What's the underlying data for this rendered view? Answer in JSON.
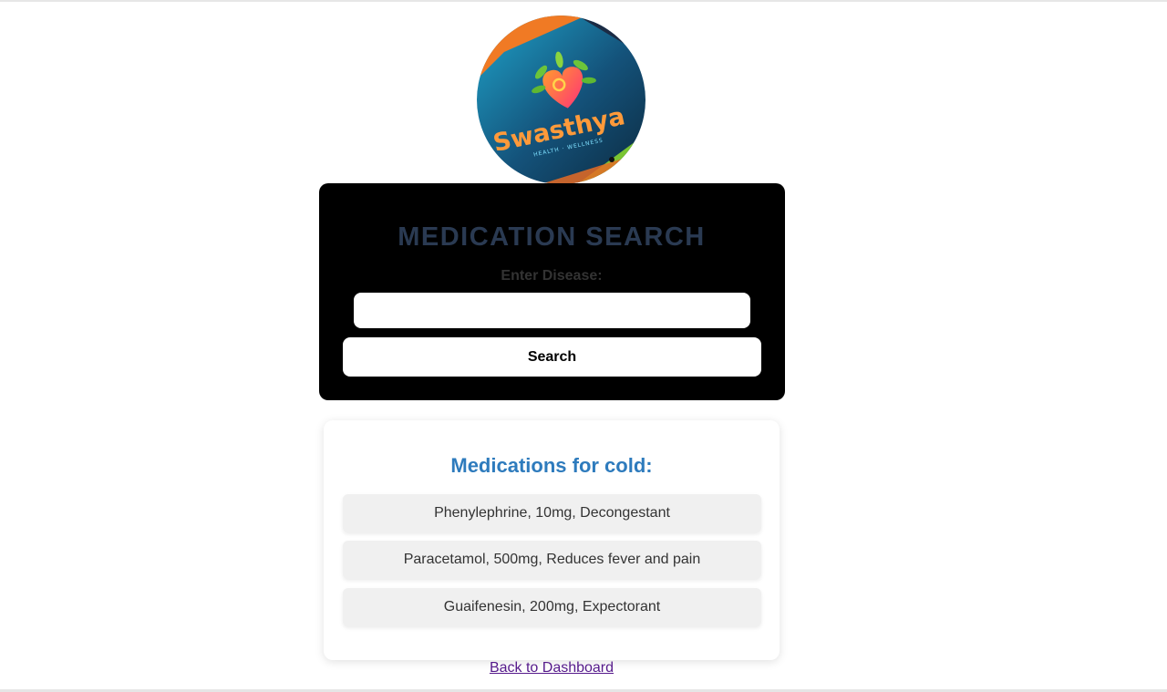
{
  "logo": {
    "brand_name": "Swasthya",
    "tagline": "HEALTH · WELLNESS"
  },
  "search": {
    "title": "MEDICATION SEARCH",
    "label": "Enter Disease:",
    "input_value": "",
    "button_label": "Search"
  },
  "results": {
    "title": "Medications for cold:",
    "items": [
      "Phenylephrine, 10mg, Decongestant",
      "Paracetamol, 500mg, Reduces fever and pain",
      "Guaifenesin, 200mg, Expectorant"
    ]
  },
  "footer": {
    "back_link_label": "Back to Dashboard"
  },
  "colors": {
    "search_card_bg": "#000000",
    "results_title": "#2e7bbd",
    "link_visited": "#551a8b"
  }
}
